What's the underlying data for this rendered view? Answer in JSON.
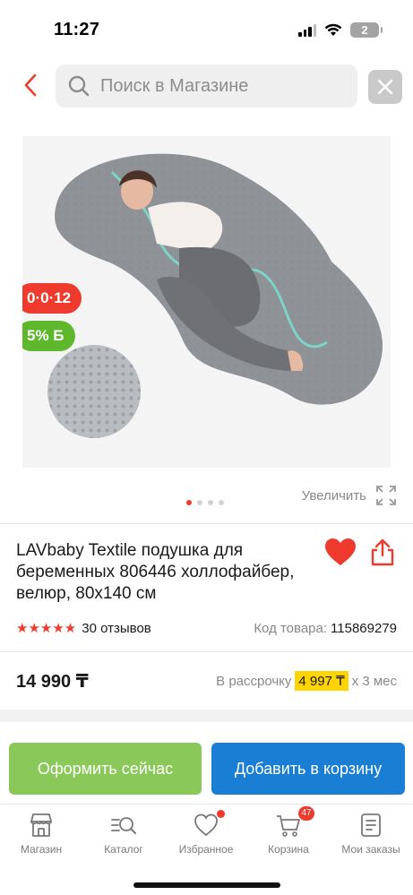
{
  "status_bar": {
    "time": "11:27",
    "battery": "2"
  },
  "search": {
    "placeholder": "Поиск в Магазине"
  },
  "product": {
    "badges": {
      "timer": "0·0·12",
      "bonus": "5% Б"
    },
    "zoom_label": "Увеличить",
    "gallery_dots": 4,
    "gallery_active_index": 0,
    "title": "LAVbaby Textile подушка для беременных 806446 холлофайбер, велюр, 80x140 см",
    "rating": {
      "stars": 5,
      "reviews": "30 отзывов"
    },
    "sku": {
      "label": "Код товара:",
      "value": "115869279"
    },
    "price": "14 990 ₸",
    "installment": {
      "prefix": "В рассрочку",
      "amount": "4 997 ₸",
      "suffix": "x 3 мес"
    }
  },
  "actions": {
    "order": "Оформить сейчас",
    "cart": "Добавить в корзину"
  },
  "tabbar": {
    "items": [
      {
        "label": "Магазин",
        "icon": "shop-icon"
      },
      {
        "label": "Каталог",
        "icon": "catalog-search-icon"
      },
      {
        "label": "Избранное",
        "icon": "heart-icon"
      },
      {
        "label": "Корзина",
        "icon": "cart-icon",
        "badge": "47"
      },
      {
        "label": "Мои заказы",
        "icon": "orders-icon"
      }
    ]
  },
  "colors": {
    "accent": "#ef3b2d",
    "order_button": "#8bc85a",
    "cart_button": "#1a7fd4",
    "installment_highlight": "#ffd400",
    "bonus_badge": "#5fb82c"
  }
}
